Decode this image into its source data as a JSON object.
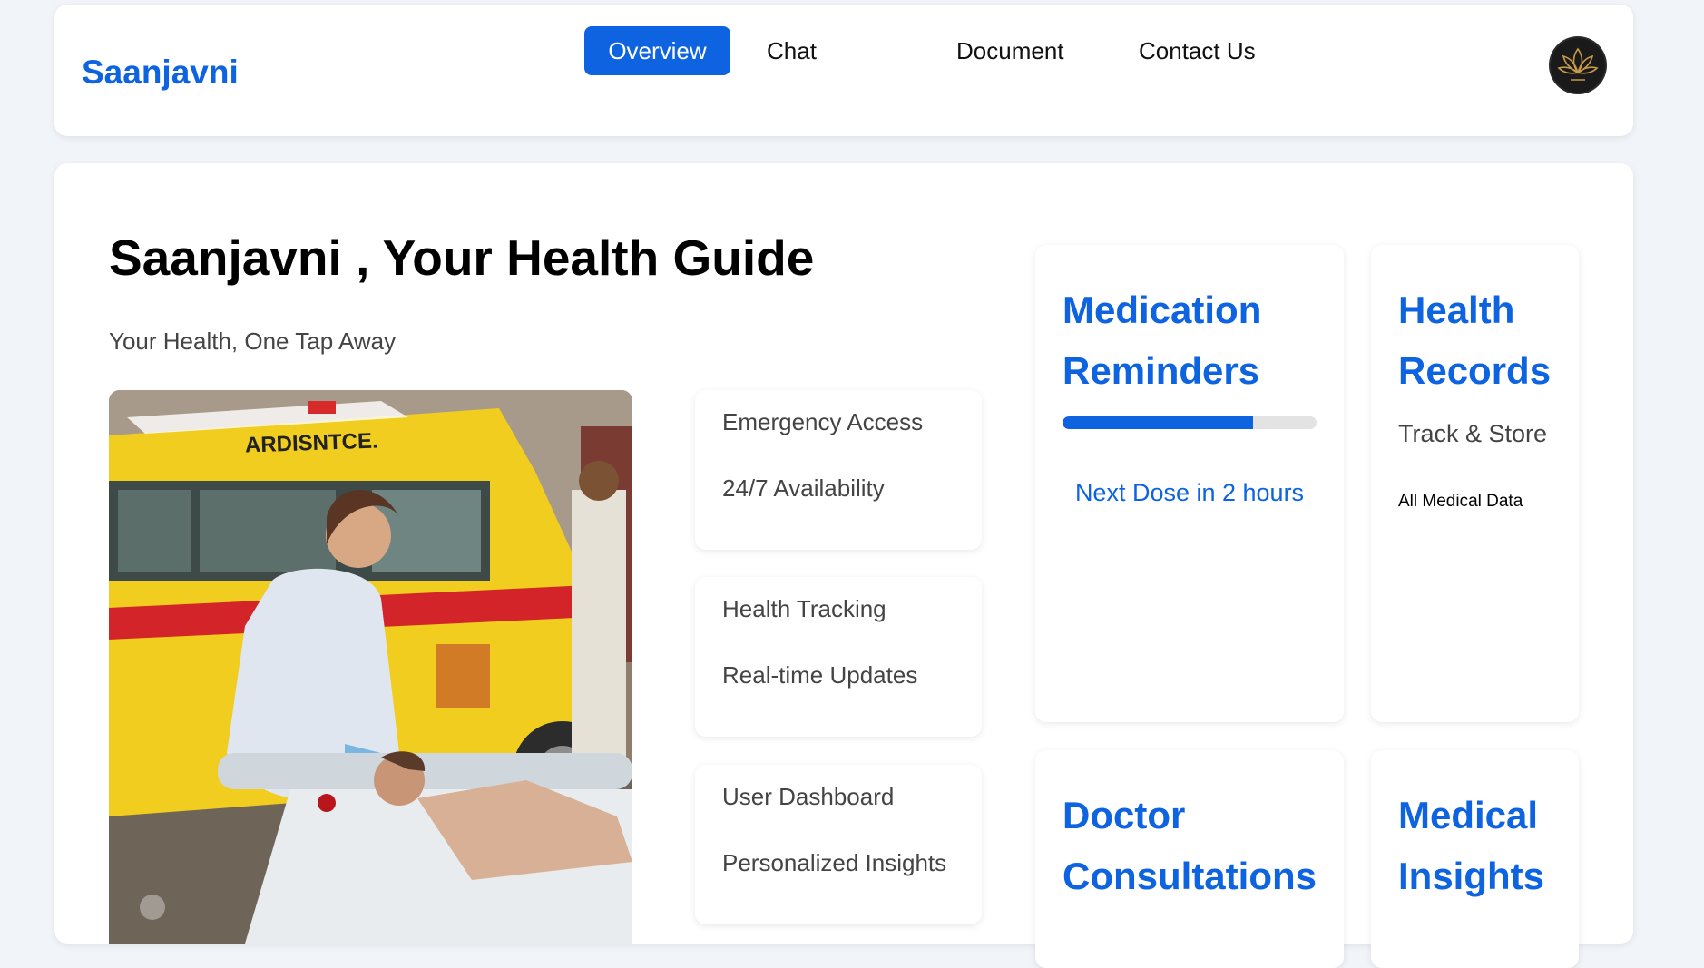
{
  "brand": "Saanjavni",
  "nav": {
    "items": [
      "Overview",
      "Chat",
      "Document",
      "Contact Us"
    ],
    "active": "Overview"
  },
  "hero": {
    "title": "Saanjavni , Your Health Guide",
    "subtitle": "Your Health, One Tap Away",
    "image_text": "ARDISNTCE."
  },
  "features": [
    {
      "title": "Emergency Access",
      "subtitle": "24/7 Availability"
    },
    {
      "title": "Health Tracking",
      "subtitle": "Real-time Updates"
    },
    {
      "title": "User Dashboard",
      "subtitle": "Personalized Insights"
    }
  ],
  "services": {
    "medication": {
      "title_line1": "Medication",
      "title_line2": "Reminders",
      "progress": 0.75,
      "note": "Next Dose in 2 hours"
    },
    "records": {
      "title_line1": "Health",
      "title_line2": "Records",
      "line1": "Track & Store",
      "line2": "All Medical Data"
    },
    "doctor": {
      "title_line1": "Doctor",
      "title_line2": "Consultations"
    },
    "insights": {
      "title_line1": "Medical",
      "title_line2": "Insights"
    }
  },
  "colors": {
    "accent": "#0d63e0",
    "page_bg": "#f1f4f8"
  },
  "icons": {
    "avatar": "lotus-logo-icon"
  }
}
